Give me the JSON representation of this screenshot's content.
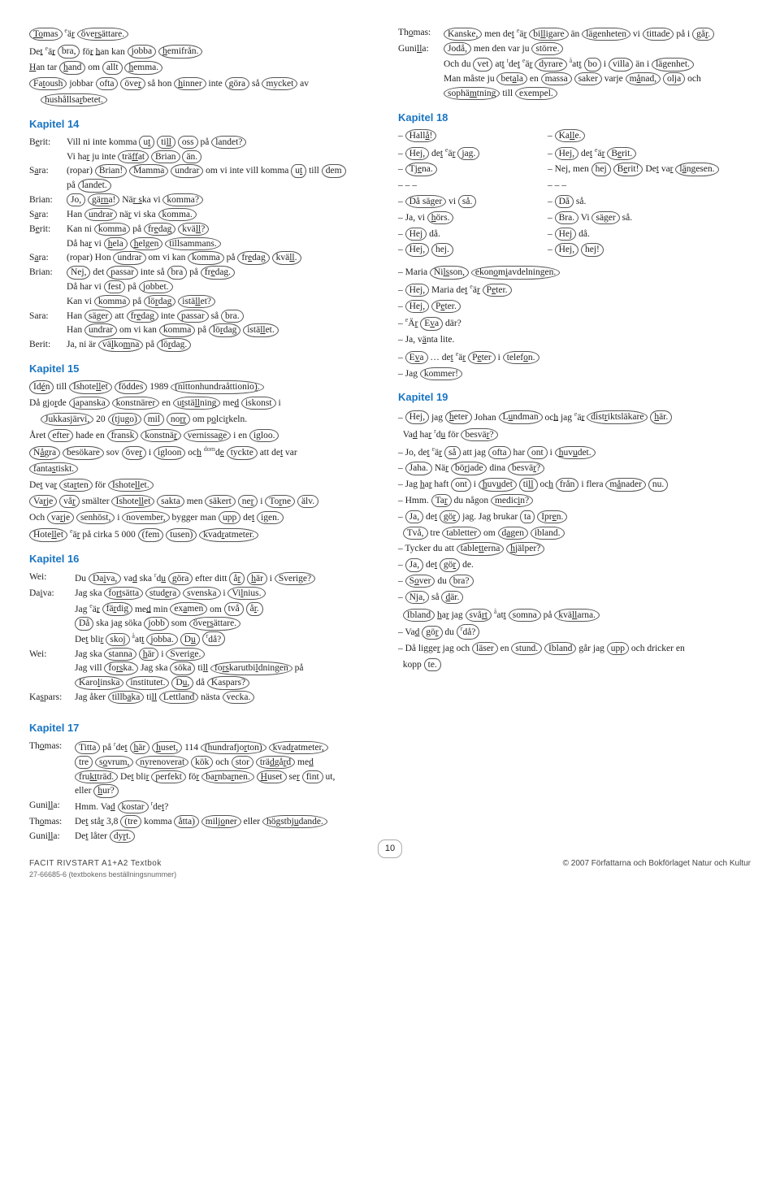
{
  "page_number": "10",
  "footer_left_main": "FACIT   RIVSTART A1+A2   Textbok",
  "footer_left_sub": "27-66685-6 (textbokens beställningsnummer)",
  "footer_right": "© 2007 Författarna och Bokförlaget Natur och Kultur",
  "chapters": {
    "k14": "Kapitel 14",
    "k15": "Kapitel 15",
    "k16": "Kapitel 16",
    "k17": "Kapitel 17",
    "k18": "Kapitel 18",
    "k19": "Kapitel 19"
  },
  "left_pre": [
    "Tomas är översättare.",
    "Det är bra, för han kan jobba hemifrån.",
    "Han tar hand om allt hemma.",
    "Fatoush jobbar ofta över så hon hinner inte göra så mycket av",
    "hushållsarbetet."
  ],
  "right_pre": [
    [
      "Thomas:",
      "Kanske, men det är billigare än lägenheten vi tittade på i går."
    ],
    [
      "Gunilla:",
      "Jodå, men den var ju större."
    ],
    [
      "",
      "Och du vet att det är dyrare att bo i villa än i lägenhet."
    ],
    [
      "",
      "Man måste ju betala en massa saker varje månad, olja och"
    ],
    [
      "",
      "sophämtning till exempel."
    ]
  ],
  "k14": [
    [
      "Berit:",
      "Vill ni inte komma ut till oss på landet?"
    ],
    [
      "",
      "Vi har ju inte träffat Brian än."
    ],
    [
      "Sara:",
      "(ropar) Brian! Mamma undrar om vi inte vill komma ut till dem"
    ],
    [
      "",
      "på landet."
    ],
    [
      "Brian:",
      "Jo, gärna! När ska vi komma?"
    ],
    [
      "Sara:",
      "Han undrar när vi ska komma."
    ],
    [
      "Berit:",
      "Kan ni komma på fredag kväll?"
    ],
    [
      "",
      "Då har vi hela helgen tillsammans."
    ],
    [
      "Sara:",
      "(ropar) Hon undrar om vi kan komma på fredag kväll."
    ],
    [
      "Brian:",
      "Nej, det passar inte så bra på fredag."
    ],
    [
      "",
      "Då har vi fest på jobbet."
    ],
    [
      "",
      "Kan vi komma på lördag istället?"
    ],
    [
      "Sara:",
      "Han säger att fredag inte passar så bra."
    ],
    [
      "",
      "Han undrar om vi kan komma på lördag istället."
    ],
    [
      "Berit:",
      "Ja, ni är välkomna på lördag."
    ]
  ],
  "k15": [
    "Idén till Ishotellet föddes 1989 (nittonhundraåttionio).",
    "Då gjorde japanska konstnärer en utställning med iskonst i",
    "Jukkasjärvi, 20 (tjugo) mil norr om polcirkeln.",
    "Året efter hade en fransk konstnär vernissage i en igloo.",
    "Några besökare sov över i igloon och de tyckte att det var",
    "fantastiskt.",
    "Det var starten för Ishotellet.",
    "Varje vår smälter Ishotellet sakta men säkert ner i Torne älv.",
    "Och varje senhöst, i november, bygger man upp det igen.",
    "Hotellet är på cirka 5 000 (fem tusen) kvadratmeter."
  ],
  "k16": [
    [
      "Wei:",
      "Du Daiva, vad ska du göra efter ditt år här i Sverige?"
    ],
    [
      "Daiva:",
      "Jag ska fortsätta studera svenska i Vilnius."
    ],
    [
      "",
      "Jag är färdig med min examen om två år."
    ],
    [
      "",
      "Då ska jag söka jobb som översättare."
    ],
    [
      "",
      "Det blir skoj att jobba. Du då?"
    ],
    [
      "Wei:",
      "Jag ska stanna här i Sverige."
    ],
    [
      "",
      "Jag vill forska. Jag ska söka till forskarutbildningen på"
    ],
    [
      "",
      "Karolinska institutet. Du, då Kaspars?"
    ],
    [
      "Kaspars:",
      "Jag åker tillbaka till Lettland nästa vecka."
    ]
  ],
  "k17": [
    [
      "Thomas:",
      "Titta på det här huset, 114 (hundrafjorton) kvadratmeter,"
    ],
    [
      "",
      "tre sovrum, nyrenoverat kök och stor trädgård med"
    ],
    [
      "",
      "fruktträd. Det blir perfekt för barnbarnen. Huset ser fint ut,"
    ],
    [
      "",
      "eller hur?"
    ],
    [
      "Gunilla:",
      "Hmm. Vad kostar det?"
    ],
    [
      "Thomas:",
      "Det står 3,8 (tre komma åtta) miljoner eller högstbjudande."
    ],
    [
      "Gunilla:",
      "Det låter dyrt."
    ]
  ],
  "k18_left": [
    "– Hallå!",
    "– Hej, det är jag.",
    "– Tjena.",
    "– – –",
    "– Då säger vi så.",
    "– Ja, vi hörs.",
    "– Hej då.",
    "– Hej, hej."
  ],
  "k18_right": [
    "– Kalle.",
    "– Hej, det är Berit.",
    "– Nej, men hej Berit! Det var längesen.",
    "– – –",
    "– Då så.",
    "– Bra. Vi säger så.",
    "– Hej då.",
    "– Hej, hej!"
  ],
  "k18_cont": [
    "– Maria Nilsson, ekonomiavdelningen.",
    "– Hej, Maria det är Peter.",
    "– Hej, Peter.",
    "– Är Eva där?",
    "– Ja, vänta lite.",
    "– Eva … det är Peter i telefon.",
    "– Jag kommer!"
  ],
  "k19": [
    "– Hej, jag heter Johan Lundman och jag är distriktsläkare här.",
    "  Vad har du för besvär?",
    "– Jo, det är så att jag ofta har ont i huvudet.",
    "– Jaha. När började dina besvär?",
    "– Jag har haft ont i huvudet till och från i flera månader nu.",
    "– Hmm. Tar du någon medicin?",
    "– Ja, det gör jag. Jag brukar ta Ipren.",
    "  Två, tre tabletter om dagen ibland.",
    "– Tycker du att tabletterna hjälper?",
    "– Ja, det gör de.",
    "– Sover du bra?",
    "– Nja, så där.",
    "  Ibland har jag svårt att somna på kvällarna.",
    "– Vad gör du då?",
    "– Då ligger jag och läser en stund. Ibland går jag upp och dricker en",
    "  kopp te."
  ]
}
